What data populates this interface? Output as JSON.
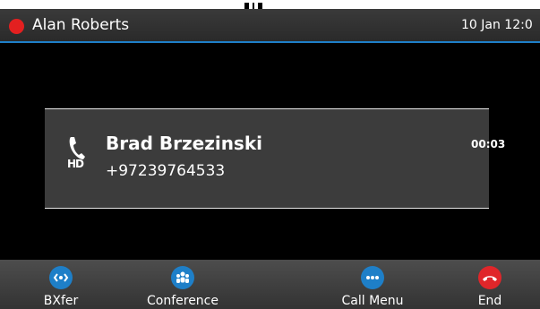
{
  "status": {
    "user_name": "Alan Roberts",
    "datetime": "10 Jan 12:0",
    "presence_color": "#e32020",
    "accent_color": "#1e7fc8"
  },
  "call": {
    "icon": "phone-handset-icon",
    "hd_label": "HD",
    "caller_name": "Brad Brzezinski",
    "caller_number": "+97239764533",
    "duration": "00:03"
  },
  "softkeys": [
    {
      "label": "BXfer",
      "icon": "blind-transfer-icon",
      "color": "#1e7fc8"
    },
    {
      "label": "Conference",
      "icon": "conference-icon",
      "color": "#1e7fc8"
    },
    {
      "label": "Call Menu",
      "icon": "more-icon",
      "color": "#1e7fc8"
    },
    {
      "label": "End",
      "icon": "end-call-icon",
      "color": "#e0262a"
    }
  ]
}
